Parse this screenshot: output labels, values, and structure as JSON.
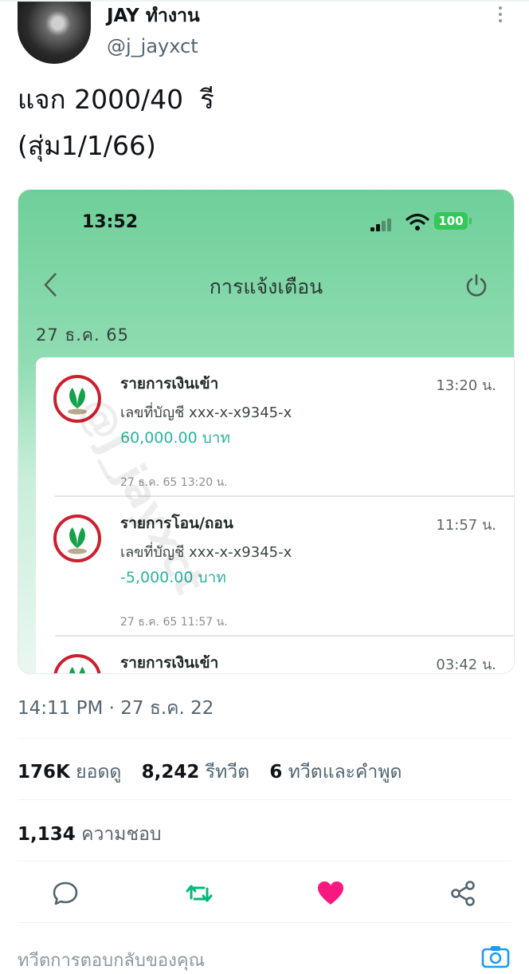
{
  "tweet": {
    "display_name": "JAY ทำงาน",
    "handle": "@j_jayxct",
    "text": "แจก 2000/40  รี\n(สุ่ม1/1/66)",
    "timestamp": "14:11 PM · 27 ธ.ค. 22"
  },
  "screenshot": {
    "status_time": "13:52",
    "battery": "100",
    "title": "การแจ้งเตือน",
    "date_header": "27 ธ.ค. 65",
    "watermark": "@j_jayxct",
    "notifications": [
      {
        "title": "รายการเงินเข้า",
        "time": "13:20 น.",
        "account": "เลขที่บัญชี xxx-x-x9345-x",
        "amount": "60,000.00 บาท",
        "stamp": "27 ธ.ค. 65 13:20 น."
      },
      {
        "title": "รายการโอน/ถอน",
        "time": "11:57 น.",
        "account": "เลขที่บัญชี xxx-x-x9345-x",
        "amount": "-5,000.00 บาท",
        "stamp": "27 ธ.ค. 65 11:57 น."
      },
      {
        "title": "รายการเงินเข้า",
        "time": "03:42 น."
      }
    ]
  },
  "stats": {
    "views_count": "176K",
    "views_label": "ยอดดู",
    "retweets_count": "8,242",
    "retweets_label": "รีทวีต",
    "quotes_count": "6",
    "quotes_label": "ทวีตและคำพูด",
    "likes_count": "1,134",
    "likes_label": "ความชอบ"
  },
  "actions": {
    "icons": [
      "reply-icon",
      "retweet-icon",
      "like-icon",
      "share-icon"
    ],
    "retweet_color": "#00ba7c",
    "like_color": "#f91880"
  },
  "reply_bar": {
    "placeholder": "ทวีตการตอบกลับของคุณ"
  },
  "colors": {
    "card_green": "#6fcf9a",
    "amount_teal": "#2bb3a0",
    "kbank_red": "#cc1f2f",
    "kbank_green": "#13a24a"
  }
}
